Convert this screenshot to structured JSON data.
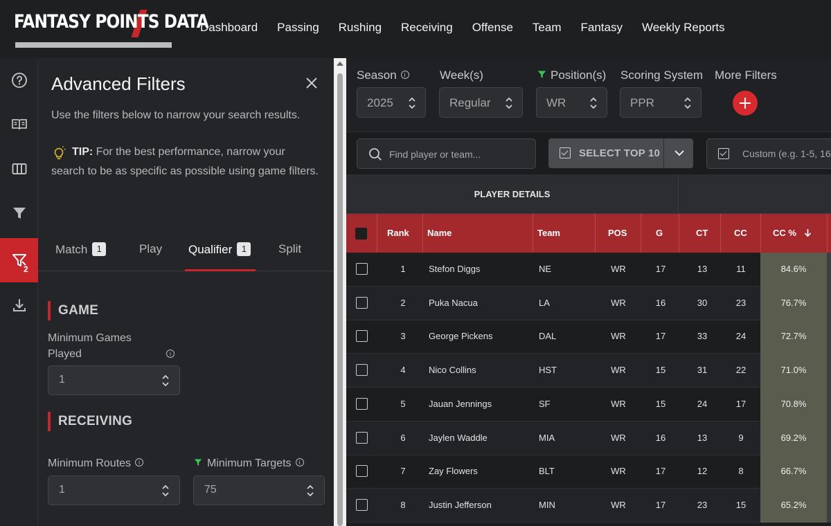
{
  "brand": {
    "logo_text": "FANTASY POINTS DATA"
  },
  "nav": [
    "Dashboard",
    "Passing",
    "Rushing",
    "Receiving",
    "Offense",
    "Team",
    "Fantasy",
    "Weekly Reports"
  ],
  "rail": {
    "active_badge": "2"
  },
  "panel": {
    "title": "Advanced Filters",
    "description": "Use the filters below to narrow your search results.",
    "tip_label": "TIP:",
    "tip_text": "For the best performance, narrow your search to be as specific as possible using game filters.",
    "tabs": [
      {
        "label": "Match",
        "badge": "1"
      },
      {
        "label": "Play",
        "badge": ""
      },
      {
        "label": "Qualifier",
        "badge": "1"
      },
      {
        "label": "Split",
        "badge": ""
      }
    ],
    "sections": {
      "game": {
        "title": "GAME",
        "min_games_label": "Minimum Games Played",
        "min_games_value": "1"
      },
      "receiving": {
        "title": "RECEIVING",
        "min_routes_label": "Minimum Routes",
        "min_routes_value": "1",
        "min_targets_label": "Minimum Targets",
        "min_targets_value": "75"
      }
    }
  },
  "filters": {
    "season_label": "Season",
    "season_value": "2025",
    "week_label": "Week(s)",
    "week_value": "Regular",
    "position_label": "Position(s)",
    "position_value": "WR",
    "scoring_label": "Scoring System",
    "scoring_value": "PPR",
    "more_label": "More Filters"
  },
  "toolbar": {
    "search_placeholder": "Find player or team...",
    "select_top_label": "SELECT TOP 10",
    "custom_placeholder": "Custom (e.g. 1-5, 16"
  },
  "table": {
    "group_header": "PLAYER DETAILS",
    "columns": [
      "Rank",
      "Name",
      "Team",
      "POS",
      "G",
      "CT",
      "CC",
      "CC %"
    ],
    "rows": [
      {
        "rank": "1",
        "name": "Stefon Diggs",
        "team": "NE",
        "pos": "WR",
        "g": "17",
        "ct": "13",
        "cc": "11",
        "ccpct": "84.6%"
      },
      {
        "rank": "2",
        "name": "Puka Nacua",
        "team": "LA",
        "pos": "WR",
        "g": "16",
        "ct": "30",
        "cc": "23",
        "ccpct": "76.7%"
      },
      {
        "rank": "3",
        "name": "George Pickens",
        "team": "DAL",
        "pos": "WR",
        "g": "17",
        "ct": "33",
        "cc": "24",
        "ccpct": "72.7%"
      },
      {
        "rank": "4",
        "name": "Nico Collins",
        "team": "HST",
        "pos": "WR",
        "g": "15",
        "ct": "31",
        "cc": "22",
        "ccpct": "71.0%"
      },
      {
        "rank": "5",
        "name": "Jauan Jennings",
        "team": "SF",
        "pos": "WR",
        "g": "15",
        "ct": "24",
        "cc": "17",
        "ccpct": "70.8%"
      },
      {
        "rank": "6",
        "name": "Jaylen Waddle",
        "team": "MIA",
        "pos": "WR",
        "g": "16",
        "ct": "13",
        "cc": "9",
        "ccpct": "69.2%"
      },
      {
        "rank": "7",
        "name": "Zay Flowers",
        "team": "BLT",
        "pos": "WR",
        "g": "17",
        "ct": "12",
        "cc": "8",
        "ccpct": "66.7%"
      },
      {
        "rank": "8",
        "name": "Justin Jefferson",
        "team": "MIN",
        "pos": "WR",
        "g": "17",
        "ct": "23",
        "cc": "15",
        "ccpct": "65.2%"
      }
    ]
  },
  "colors": {
    "accent": "#c9262b",
    "header_row": "#a3292d",
    "filter_active": "#3cc45a"
  }
}
